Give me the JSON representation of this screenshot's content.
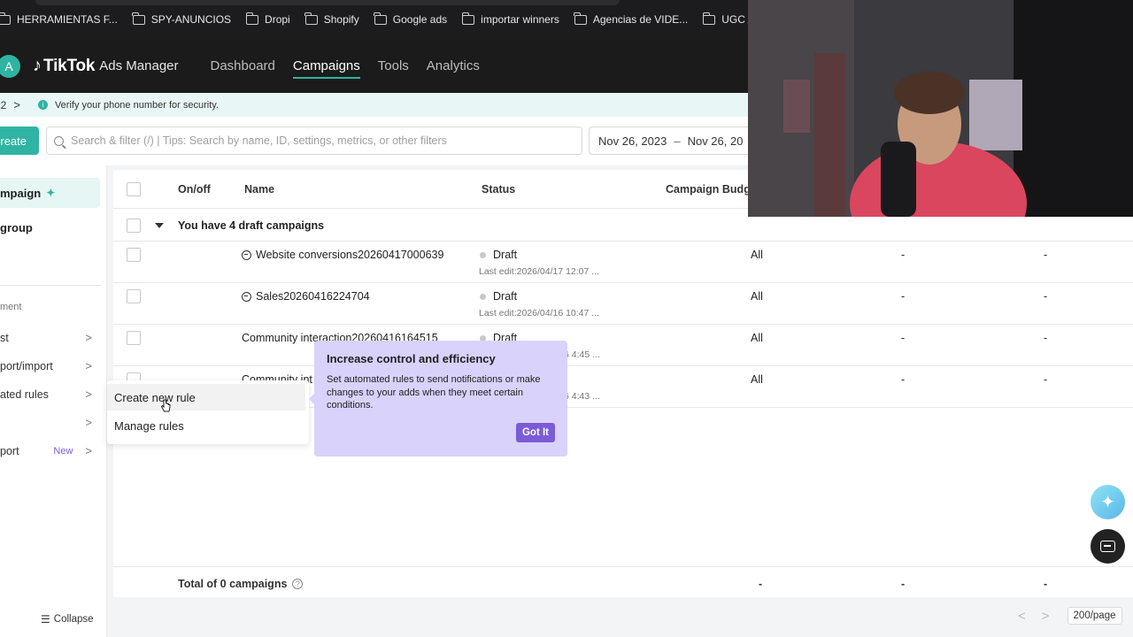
{
  "bookmarks": [
    {
      "label": "HERRAMIENTAS F...",
      "icon": "folder-icon"
    },
    {
      "label": "SPY-ANUNCIOS",
      "icon": "folder-icon"
    },
    {
      "label": "Dropi",
      "icon": "folder-icon"
    },
    {
      "label": "Shopify",
      "icon": "folder-icon"
    },
    {
      "label": "Google ads",
      "icon": "folder-icon"
    },
    {
      "label": "importar winners",
      "icon": "folder-icon"
    },
    {
      "label": "Agencias de VIDE...",
      "icon": "folder-icon"
    },
    {
      "label": "UGC AI",
      "icon": "folder-icon"
    }
  ],
  "header": {
    "avatar_initial": "A",
    "logo_brand": "TikTok",
    "logo_sub": "Ads Manager",
    "nav": [
      "Dashboard",
      "Campaigns",
      "Tools",
      "Analytics"
    ],
    "active_nav": "Campaigns",
    "accent_color": "#2fb4a3"
  },
  "banner": {
    "pager": "/ 2",
    "chevron": ">",
    "message": "Verify your phone number for security."
  },
  "toolbar": {
    "create_label": "reate",
    "search_placeholder": "Search & filter (/) | Tips: Search by name, ID, settings, metrics, or other filters",
    "date_start": "Nov 26, 2023",
    "date_sep": "–",
    "date_end": "Nov 26, 20"
  },
  "sidebar": {
    "active_item": "mpaign",
    "group_item": "group",
    "section_label": "ment",
    "links": [
      {
        "label": "st",
        "arrow": ">"
      },
      {
        "label": "port/import",
        "arrow": ">"
      },
      {
        "label": "ated rules",
        "arrow": ">"
      },
      {
        "label": "",
        "arrow": ">"
      },
      {
        "label": "port",
        "badge": "New",
        "arrow": ">"
      }
    ],
    "collapse_label": "Collapse"
  },
  "table": {
    "columns": [
      "On/off",
      "Name",
      "Status",
      "Campaign Budg"
    ],
    "group_label": "You have 4 draft campaigns",
    "rows": [
      {
        "name": "Website conversions20260417000639",
        "has_icon": true,
        "status": "Draft",
        "last_edit": "Last edit:2026/04/17 12:07 ...",
        "budget": "All",
        "m1": "-",
        "m2": "-"
      },
      {
        "name": "Sales20260416224704",
        "has_icon": true,
        "status": "Draft",
        "last_edit": "Last edit:2026/04/16 10:47 ...",
        "budget": "All",
        "m1": "-",
        "m2": "-"
      },
      {
        "name": "Community interaction20260416164515",
        "has_icon": false,
        "status": "Draft",
        "last_edit": "6 4:45 ...",
        "budget": "All",
        "m1": "-",
        "m2": "-"
      },
      {
        "name": "Community int",
        "has_icon": false,
        "status": "",
        "last_edit": "6 4:43 ...",
        "budget": "All",
        "m1": "-",
        "m2": "-"
      }
    ],
    "footer": {
      "total_label": "Total of 0 campaigns",
      "help": "?",
      "d1": "-",
      "d2": "-",
      "d3": "-"
    }
  },
  "pagination": {
    "prev": "<",
    "next": ">",
    "per_page": "200/page"
  },
  "menu": {
    "items": [
      "Create new rule",
      "Manage rules"
    ]
  },
  "tooltip": {
    "title": "Increase control and efficiency",
    "body": "Set automated rules to send notifications or make changes to your adds when they meet certain conditions.",
    "button": "Got It",
    "bg_color": "#d9d2fb",
    "button_color": "#7b5cd6"
  }
}
